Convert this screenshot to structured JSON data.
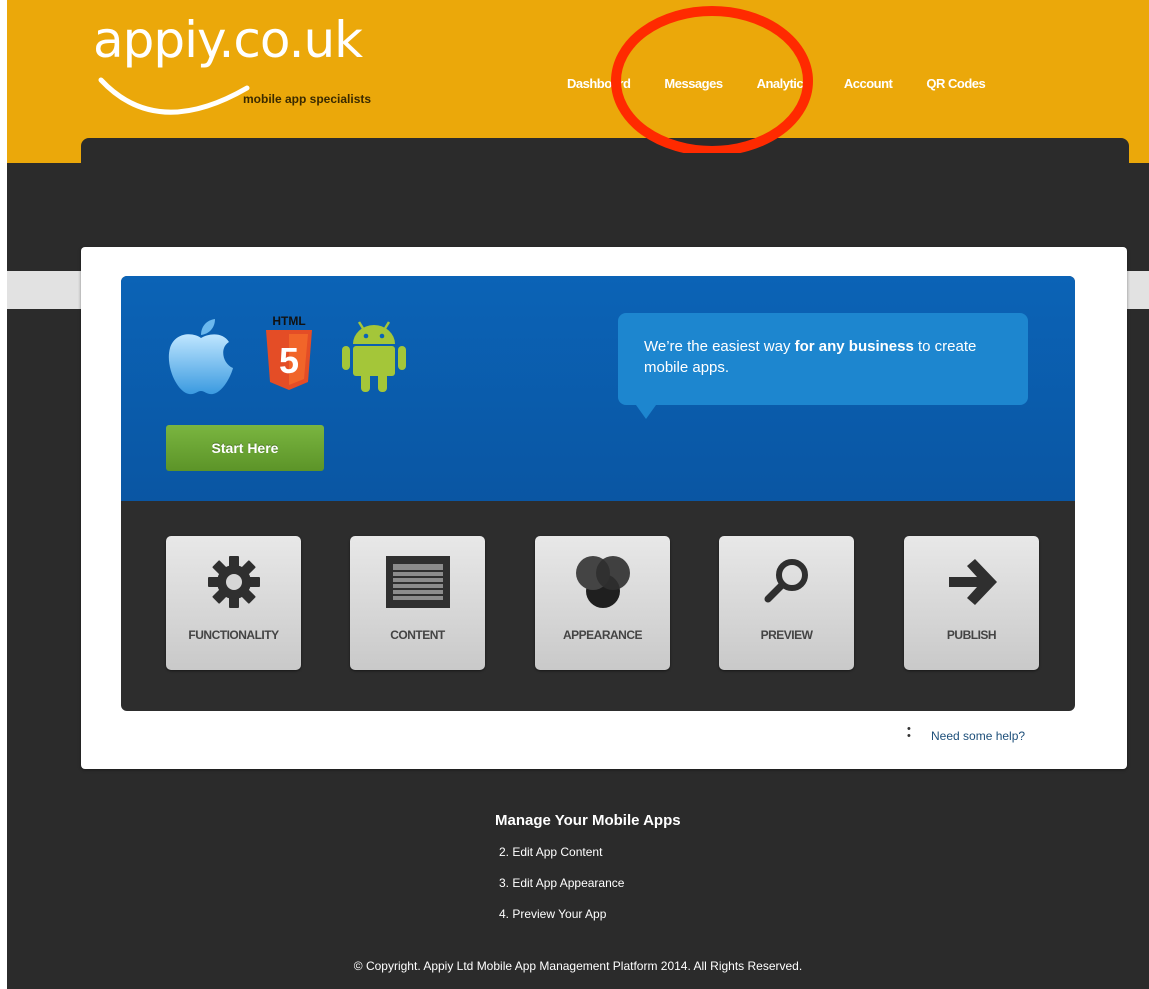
{
  "header": {
    "logo_main": "appiy.co.uk",
    "logo_tagline": "mobile app specialists",
    "nav": [
      "Dashboard",
      "Messages",
      "Analytics",
      "Account",
      "QR Codes"
    ]
  },
  "hero": {
    "platform_icons": [
      "apple-icon",
      "html5-icon",
      "android-icon"
    ],
    "html5_badge": "HTML",
    "html5_number": "5",
    "start_button": "Start Here",
    "bubble_text_1": "We’re the easiest way ",
    "bubble_text_bold": "for any business",
    "bubble_text_2": " to create mobile apps."
  },
  "tiles": [
    {
      "label": "FUNCTIONALITY",
      "icon": "gear-icon"
    },
    {
      "label": "CONTENT",
      "icon": "content-icon"
    },
    {
      "label": "APPEARANCE",
      "icon": "appearance-icon"
    },
    {
      "label": "PREVIEW",
      "icon": "magnifier-icon"
    },
    {
      "label": "PUBLISH",
      "icon": "arrow-right-icon"
    }
  ],
  "help": {
    "label": "Need some help?"
  },
  "footer": {
    "heading": "Manage Your Mobile Apps",
    "links": [
      "2. Edit App Content",
      "3. Edit App Appearance",
      "4. Preview Your App"
    ],
    "copyright": "© Copyright. Appiy Ltd Mobile App Management Platform 2014. All Rights Reserved."
  },
  "colors": {
    "header_bg": "#eba80a",
    "page_bg": "#2b2b2b",
    "hero_blue": "#0b63b6",
    "bubble_blue": "#1d86cf",
    "start_green": "#6aa633",
    "annotation_red": "#ff2a00"
  }
}
